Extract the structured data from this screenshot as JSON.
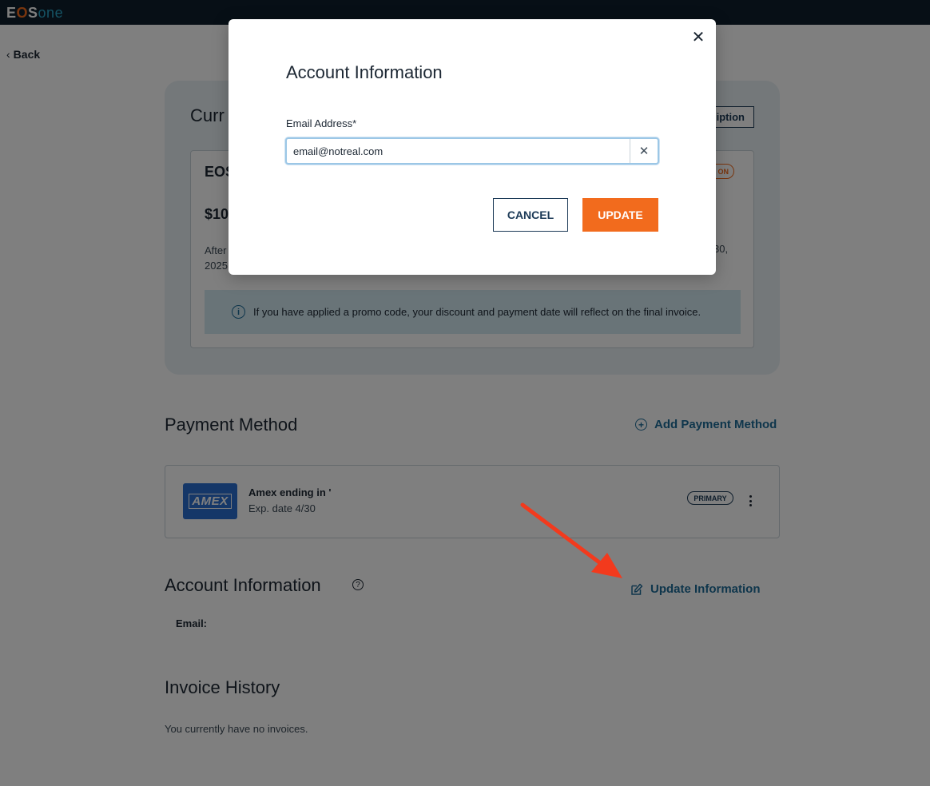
{
  "header": {
    "logo": {
      "e": "E",
      "o": "O",
      "s": "S",
      "one": "one"
    }
  },
  "nav": {
    "back_label": "Back"
  },
  "subscription": {
    "title": "Curr",
    "button_label": "iption",
    "plan_name": "EOS",
    "badge": "ON",
    "price": "$10",
    "after_text_line1": "After",
    "after_text_line2": "2025",
    "date_text": "30,",
    "promo_notice": "If you have applied a promo code, your discount and payment date will reflect on the final invoice."
  },
  "payment_method": {
    "title": "Payment Method",
    "add_label": "Add Payment Method",
    "card": {
      "brand_logo": "AMEX",
      "name": "Amex ending in '",
      "expiry": "Exp. date 4/30",
      "badge": "PRIMARY"
    }
  },
  "account_info": {
    "title": "Account Information",
    "update_label": "Update Information",
    "email_label": "Email:"
  },
  "invoice_history": {
    "title": "Invoice History",
    "empty_text": "You currently have no invoices."
  },
  "modal": {
    "title": "Account Information",
    "field_label": "Email Address*",
    "email_value": "email@notreal.com",
    "cancel_label": "CANCEL",
    "update_label": "UPDATE"
  },
  "colors": {
    "accent": "#f26b1d",
    "link": "#1f6d99",
    "topbar": "#0f1e2d",
    "annotation_arrow": "#f23a1d"
  }
}
